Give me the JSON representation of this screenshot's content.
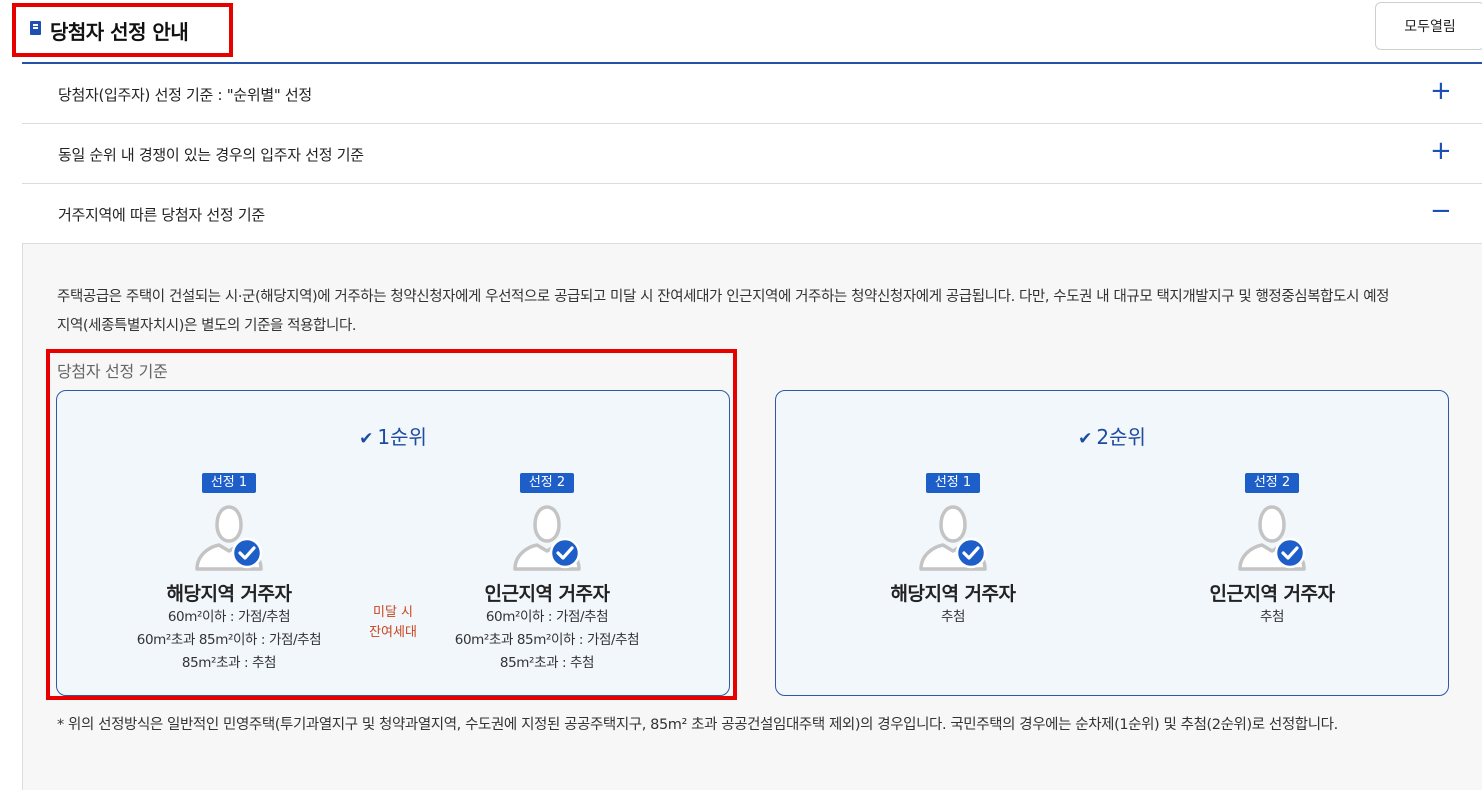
{
  "header": {
    "title": "당첨자 선정 안내",
    "expand_all_label": "모두열림",
    "highlight_color": "#e60000",
    "accent_color": "#1e50b4",
    "title_icon": "book-icon"
  },
  "accordion": [
    {
      "label": "당첨자(입주자) 선정 기준 : \"순위별\" 선정",
      "sign": "+",
      "expanded": false
    },
    {
      "label": "동일 순위 내 경쟁이 있는 경우의 입주자 선정 기준",
      "sign": "+",
      "expanded": false
    },
    {
      "label": "거주지역에 따른 당첨자 선정 기준",
      "sign": "−",
      "expanded": true
    }
  ],
  "panel": {
    "intro": "주택공급은 주택이 건설되는 시·군(해당지역)에 거주하는 청약신청자에게 우선적으로 공급되고 미달 시 잔여세대가 인근지역에 거주하는 청약신청자에게 공급됩니다. 다만, 수도권 내 대규모 택지개발지구 및 행정중심복합도시 예정지역(세종특별자치시)은 별도의 기준을 적용합니다.",
    "section_label": "당첨자 선정 기준",
    "check_glyph": "✔",
    "cards": [
      {
        "rank": "1순위",
        "columns": [
          {
            "badge": "선정 1",
            "who": "해당지역 거주자",
            "criteria": [
              "60m²이하 : 가점/추첨",
              "60m²초과 85m²이하 : 가점/추첨",
              "85m²초과 : 추첨"
            ]
          },
          {
            "badge": "선정 2",
            "who": "인근지역 거주자",
            "criteria": [
              "60m²이하 : 가점/추첨",
              "60m²초과 85m²이하 : 가점/추첨",
              "85m²초과 : 추첨"
            ]
          }
        ],
        "between_line1": "미달 시",
        "between_line2": "잔여세대"
      },
      {
        "rank": "2순위",
        "columns": [
          {
            "badge": "선정 1",
            "who": "해당지역 거주자",
            "criteria": [
              "추첨"
            ]
          },
          {
            "badge": "선정 2",
            "who": "인근지역 거주자",
            "criteria": [
              "추첨"
            ]
          }
        ]
      }
    ],
    "note": "* 위의 선정방식은 일반적인 민영주택(투기과열지구 및 청약과열지역, 수도권에 지정된 공공주택지구, 85m² 초과 공공건설임대주택 제외)의 경우입니다. 국민주택의 경우에는 순차제(1순위) 및 추첨(2순위)로 선정합니다."
  }
}
